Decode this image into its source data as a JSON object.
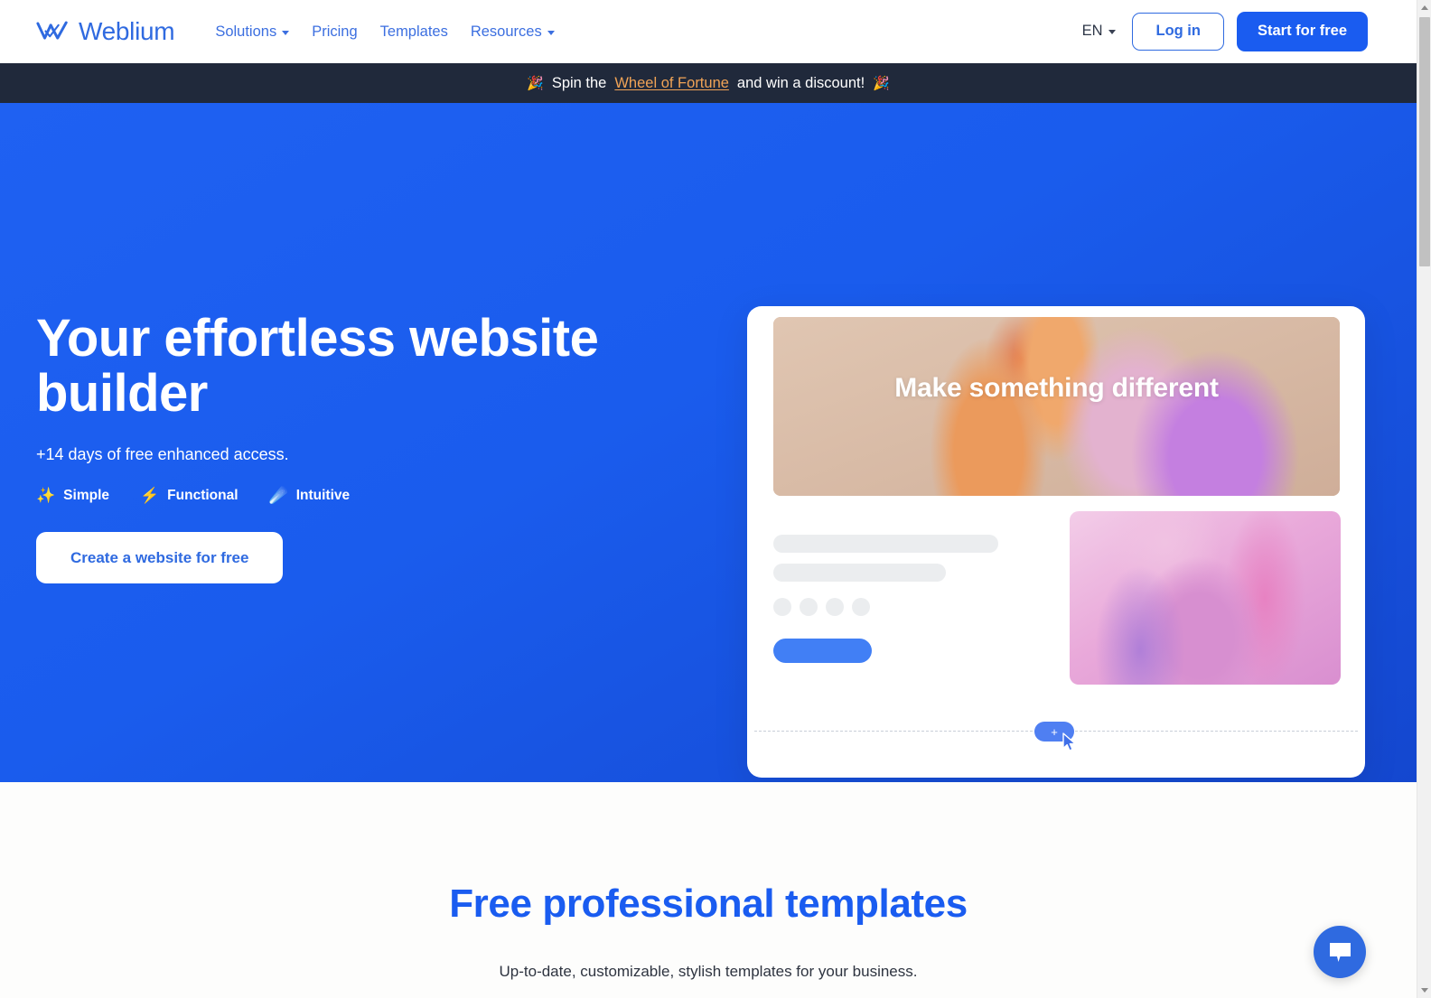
{
  "brand": {
    "name": "Weblium",
    "logo_icon": "weblium-w-check-logo",
    "accent": "#1a5cf0",
    "link_blue": "#3c6fe0"
  },
  "header": {
    "nav": [
      {
        "label": "Solutions",
        "has_dropdown": true
      },
      {
        "label": "Pricing",
        "has_dropdown": false
      },
      {
        "label": "Templates",
        "has_dropdown": false
      },
      {
        "label": "Resources",
        "has_dropdown": true
      }
    ],
    "language": "EN",
    "login_label": "Log in",
    "start_label": "Start for free"
  },
  "announcement": {
    "emoji_left": "🎉",
    "emoji_right": "🎉",
    "text_before": "Spin the",
    "link_text": "Wheel of Fortune",
    "text_after": "and win a discount!",
    "background": "#20293b",
    "link_color": "#f0a356"
  },
  "hero": {
    "title": "Your effortless website builder",
    "subtitle": "+14 days of free enhanced access.",
    "badges": [
      {
        "emoji": "✨",
        "label": "Simple",
        "icon": "sparkles-icon"
      },
      {
        "emoji": "⚡",
        "label": "Functional",
        "icon": "lightning-bolt-icon"
      },
      {
        "emoji": "☄️",
        "label": "Intuitive",
        "icon": "comet-icon"
      }
    ],
    "cta_label": "Create a website for free",
    "background": "#1a5cf0"
  },
  "mockup": {
    "banner_text": "Make something different",
    "placeholder_dots": 4,
    "add_block_label": "+",
    "cursor_icon": "mouse-pointer-icon"
  },
  "templates_section": {
    "title": "Free professional templates",
    "subtitle": "Up-to-date, customizable, stylish templates for your business."
  },
  "chat": {
    "icon": "chat-bubble-icon",
    "color": "#2f6ae0"
  },
  "scrollbar": {
    "up_icon": "scroll-up-arrow-icon",
    "down_icon": "scroll-down-arrow-icon"
  }
}
